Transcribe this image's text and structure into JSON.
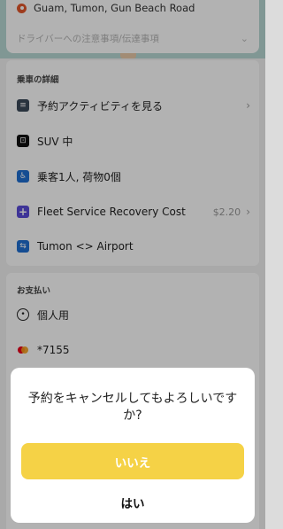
{
  "address": {
    "text": "Guam, Tumon, Gun Beach Road",
    "note_placeholder": "ドライバーへの注意事項/伝達事項"
  },
  "ride_details": {
    "title": "乗車の詳細",
    "items": [
      {
        "label": "予約アクティビティを見る",
        "value": "",
        "icon": "document-icon"
      },
      {
        "label": "SUV 中",
        "value": "",
        "icon": "car-icon"
      },
      {
        "label": "乗客1人, 荷物0個",
        "value": "",
        "icon": "seat-icon"
      },
      {
        "label": "Fleet Service Recovery Cost",
        "value": "$2.20",
        "icon": "plus-icon"
      },
      {
        "label": "Tumon <> Airport",
        "value": "",
        "icon": "route-icon"
      }
    ]
  },
  "payment": {
    "title": "お支払い",
    "profile": "個人用",
    "card": "*7155"
  },
  "dialog": {
    "message": "予約をキャンセルしてもよろしいですか?",
    "no_label": "いいえ",
    "yes_label": "はい"
  },
  "colors": {
    "accent_yellow": "#f5d246",
    "pin_orange": "#e2572b",
    "fee_purple": "#5a4bd8",
    "info_blue": "#1f6fd1"
  }
}
